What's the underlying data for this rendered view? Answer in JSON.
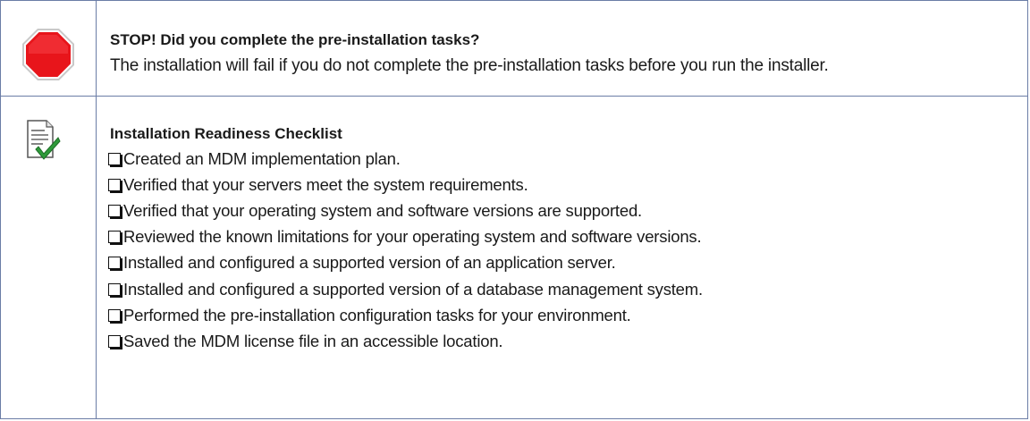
{
  "stop_block": {
    "icon": "stop-sign-icon",
    "title": "STOP! Did you complete the pre-installation tasks?",
    "body": "The installation will fail if you do not complete the pre-installation tasks before you run the installer."
  },
  "checklist_block": {
    "icon": "checklist-document-icon",
    "title": "Installation Readiness Checklist",
    "items": [
      "Created an MDM implementation plan.",
      "Verified that your servers meet the system requirements.",
      "Verified that your operating system and software versions are supported.",
      "Reviewed the known limitations for your operating system and software versions.",
      "Installed and configured a supported version of an application server.",
      "Installed and configured a supported version of a database management system.",
      "Performed the pre-installation configuration tasks for your environment.",
      "Saved the MDM license file in an accessible location."
    ]
  },
  "colors": {
    "border": "#6b7da6",
    "stop_red": "#e8151b",
    "check_green": "#2e9a3a"
  }
}
